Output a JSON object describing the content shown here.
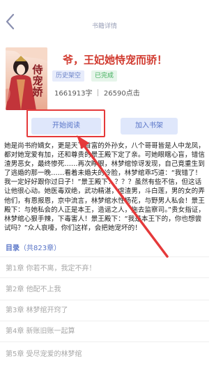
{
  "header": {
    "title": "书籍详情"
  },
  "book": {
    "cover_text": "侍宠娇",
    "title": "爷，王妃她恃宠而骄！",
    "tags": [
      "历史架空",
      "已完成"
    ],
    "stats": "1661913字 ｜ 26590点击"
  },
  "actions": {
    "read_label": "开始阅读",
    "add_label": "加入书架"
  },
  "description": "她是尚书府嫡女，更是天下首富的外孙女，八个哥哥皆是人中龙凤，都对她宠爱有加，还和尊贵的景王殿下定了亲。可她眼瞎心盲，错信渣男恶女，最终惨死……再次睁眼，林梦绾惊讶发现，自己竟重生到了逃婚的那一晚……看着未婚夫的冷脸，林梦绾乖巧道：“我错了！我一定好好跟你过日子！”景王殿下：？？？虽然有些不信，但这话让他很心动。她医毒双绝，武功精湛，虐渣男，斗白莲，男的女的弄他们，有恩报恩，京中流言，林梦绾水性杨花，与野男人私会！景王殿下：与她私会的人正是本王，造谣之人，拖去监察司。”贵女指证，林梦绾心狠手辣，下毒害人！景王殿下：“我是本王下的，你也想尝试吗？”众人哀嚎，你们这样，会把她宠坏的！",
  "toc": {
    "label": "目录",
    "count": "（共823章）",
    "chapters": [
      "第1章 你若不离，我定不弃！",
      "第2章 他配不上我",
      "第3章 林梦绾开窍了",
      "第4章 新账旧账一起算",
      "第5章 受尽宠爱的林梦绾"
    ]
  },
  "colors": {
    "accent": "#5874c7",
    "title_red": "#d13a2f",
    "annotation_red": "#e5393a"
  }
}
